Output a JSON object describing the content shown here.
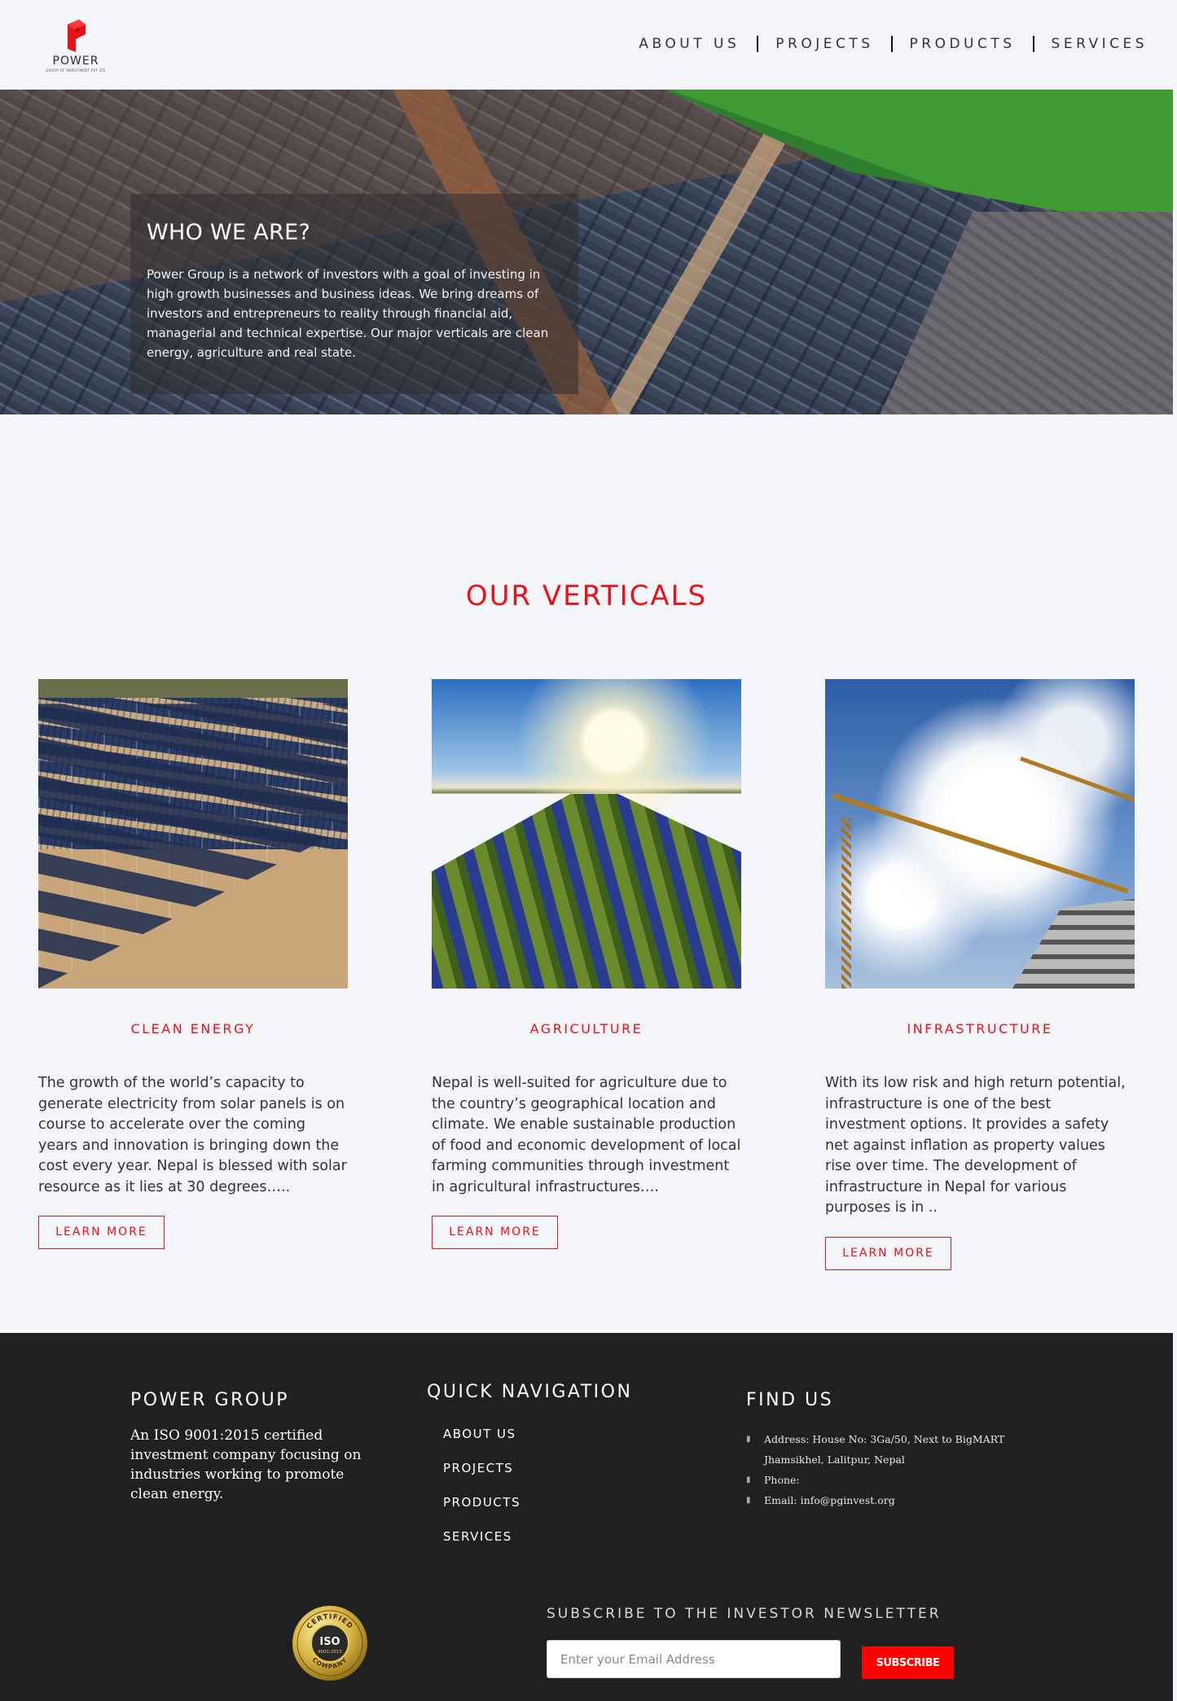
{
  "brand": {
    "name": "POWER",
    "tagline": "GROUP OF INVESTMENT PVT LTD",
    "accent_color": "#e8121a"
  },
  "nav": {
    "items": [
      {
        "label": "ABOUT US"
      },
      {
        "label": "PROJECTS"
      },
      {
        "label": "PRODUCTS"
      },
      {
        "label": "SERVICES"
      }
    ]
  },
  "hero": {
    "title": "WHO WE ARE?",
    "text": "Power Group is a network of investors with a goal of investing in high growth businesses and business ideas. We bring dreams of investors and entrepreneurs to reality through financial aid, managerial and technical expertise. Our major verticals are clean energy, agriculture and real state."
  },
  "verticals": {
    "title": "OUR VERTICALS",
    "cards": [
      {
        "category": "CLEAN ENERGY",
        "description": "The growth of the world’s capacity to generate electricity from solar panels is on course to accelerate over the coming years and innovation is bringing down the cost every year. Nepal is blessed with solar resource as it lies at 30 degrees…..",
        "button": "LEARN MORE"
      },
      {
        "category": "AGRICULTURE",
        "description": "Nepal is well-suited for agriculture due to the country’s geographical location and climate. We enable sustainable production of food and economic development of local farming communities through investment in agricultural infrastructures….",
        "button": "LEARN MORE"
      },
      {
        "category": "INFRASTRUCTURE",
        "description": "With its low risk and high return potential, infrastructure is one of the best investment options. It provides a safety net against inflation as property values rise over time. The development of infrastructure in Nepal for various purposes is in ..",
        "button": "LEARN MORE"
      }
    ]
  },
  "footer": {
    "about": {
      "title": "POWER GROUP",
      "text": "An ISO 9001:2015 certified investment company focusing on industries working to promote clean energy."
    },
    "quick_nav": {
      "title": "QUICK NAVIGATION",
      "links": [
        {
          "label": "ABOUT US"
        },
        {
          "label": "PROJECTS"
        },
        {
          "label": "PRODUCTS"
        },
        {
          "label": "SERVICES"
        }
      ]
    },
    "find_us": {
      "title": "FIND US",
      "address_line1": "Address: House No: 3Ga/50, Next to BigMART",
      "address_line2": "Jhamsikhel, Lalitpur, Nepal",
      "phone": "Phone:",
      "email": "Email: info@pginvest.org"
    },
    "iso_badge": {
      "top": "CERTIFIED",
      "center": "ISO",
      "standard": "9001:2015",
      "bottom": "COMPANY"
    },
    "newsletter": {
      "title": "SUBSCRIBE TO THE INVESTOR NEWSLETTER",
      "placeholder": "Enter your Email Address",
      "button": "SUBSCRIBE"
    }
  }
}
